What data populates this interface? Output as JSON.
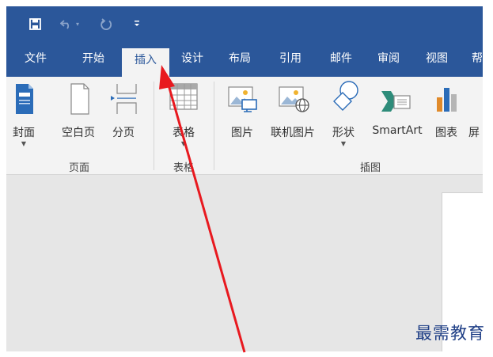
{
  "quick_access": {
    "save_icon": "save-icon",
    "undo_icon": "undo-icon",
    "redo_icon": "redo-icon",
    "customize_icon": "customize-dropdown-icon"
  },
  "tabs": [
    {
      "label": "文件"
    },
    {
      "label": "开始"
    },
    {
      "label": "插入",
      "active": true
    },
    {
      "label": "设计"
    },
    {
      "label": "布局"
    },
    {
      "label": "引用"
    },
    {
      "label": "邮件"
    },
    {
      "label": "审阅"
    },
    {
      "label": "视图"
    },
    {
      "label": "帮"
    }
  ],
  "ribbon": {
    "pages_group": {
      "label": "页面",
      "buttons": [
        {
          "label": "封面",
          "has_dropdown": true
        },
        {
          "label": "空白页"
        },
        {
          "label": "分页"
        }
      ]
    },
    "tables_group": {
      "label": "表格",
      "buttons": [
        {
          "label": "表格",
          "has_dropdown": true
        }
      ]
    },
    "illustrations_group": {
      "label": "插图",
      "buttons": [
        {
          "label": "图片"
        },
        {
          "label": "联机图片"
        },
        {
          "label": "形状",
          "has_dropdown": true
        },
        {
          "label": "SmartArt"
        },
        {
          "label": "图表"
        },
        {
          "label": "屏"
        }
      ]
    }
  },
  "watermark": "最需教育",
  "colors": {
    "title_bar": "#2b579a",
    "ribbon_bg": "#f3f3f3",
    "doc_bg": "#e6e6e6",
    "annotation_arrow": "#e8191f"
  }
}
